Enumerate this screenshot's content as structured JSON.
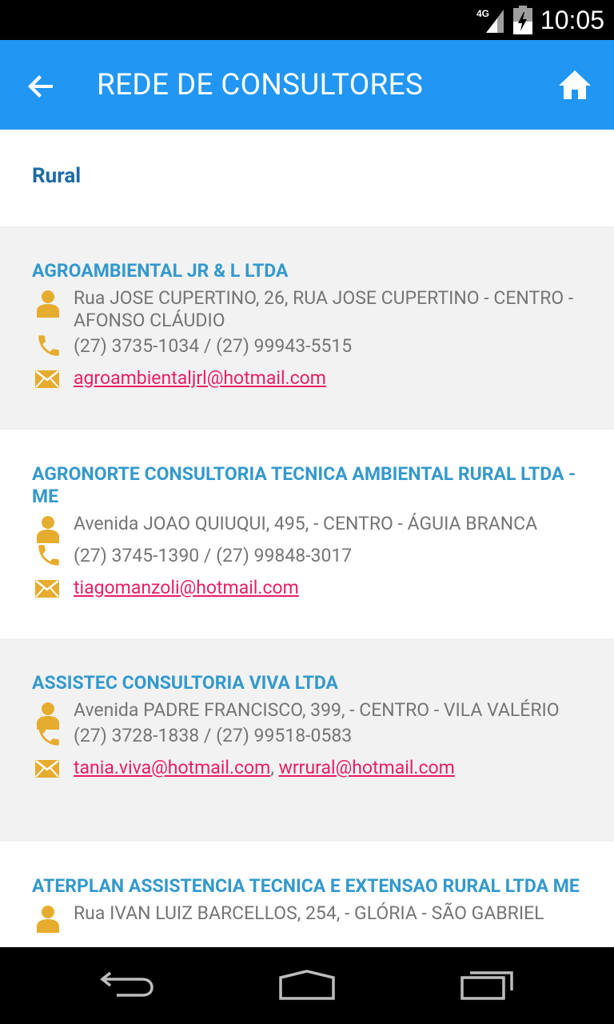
{
  "status_bar": {
    "time": "10:05",
    "network_label": "4G",
    "icons": [
      "signal-icon",
      "battery-icon"
    ]
  },
  "app_bar": {
    "title": "REDE DE CONSULTORES",
    "back_icon": "arrow-left-icon",
    "home_icon": "home-icon",
    "color": "#2196f3"
  },
  "section": {
    "label": "Rural"
  },
  "consultants": [
    {
      "name": "AGROAMBIENTAL JR & L LTDA",
      "address": "Rua JOSE CUPERTINO, 26, RUA JOSE CUPERTINO - CENTRO - AFONSO CLÁUDIO",
      "phone": "(27) 3735-1034 / (27) 99943-5515",
      "emails": [
        "agroambientaljrl@hotmail.com"
      ]
    },
    {
      "name": "AGRONORTE CONSULTORIA TECNICA AMBIENTAL RURAL LTDA - ME",
      "address": "Avenida JOAO QUIUQUI, 495,  - CENTRO - ÁGUIA BRANCA",
      "phone": "(27) 3745-1390 / (27) 99848-3017",
      "emails": [
        "tiagomanzoli@hotmail.com"
      ]
    },
    {
      "name": "ASSISTEC CONSULTORIA VIVA LTDA",
      "address": "Avenida PADRE FRANCISCO, 399,  - CENTRO - VILA VALÉRIO",
      "phone": "(27) 3728-1838 / (27) 99518-0583",
      "emails": [
        "tania.viva@hotmail.com",
        "wrrural@hotmail.com"
      ]
    },
    {
      "name": "ATERPLAN ASSISTENCIA TECNICA E EXTENSAO RURAL LTDA ME",
      "address": "Rua IVAN LUIZ BARCELLOS, 254,  - GLÓRIA - SÃO GABRIEL",
      "phone": "",
      "emails": []
    }
  ],
  "email_separator": ",",
  "colors": {
    "title_blue": "#3399cc",
    "section_blue": "#1d6aa5",
    "link_pink": "#e91e63",
    "icon_gold": "#e6ac2e",
    "alt_row_bg": "#f2f2f2"
  },
  "nav_bar": {
    "buttons": [
      "back-nav-icon",
      "home-nav-icon",
      "recents-nav-icon"
    ]
  }
}
